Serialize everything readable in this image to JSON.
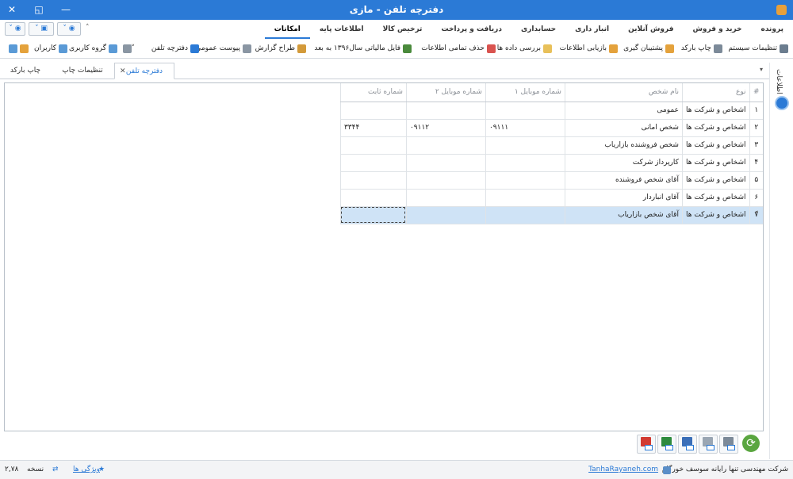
{
  "window": {
    "title": "دفترچه تلفن - مازی",
    "minimize_glyph": "—",
    "restore_glyph": "◱",
    "close_glyph": "✕"
  },
  "menu": {
    "tabs": [
      {
        "label": "پرونده"
      },
      {
        "label": "خرید و فروش"
      },
      {
        "label": "فروش آنلاین"
      },
      {
        "label": "انبار داری"
      },
      {
        "label": "حسابداری"
      },
      {
        "label": "دریافت و پرداخت"
      },
      {
        "label": "ترخیص کالا"
      },
      {
        "label": "اطلاعات پایه"
      },
      {
        "label": "امکانات"
      }
    ],
    "active_tab": "امکانات",
    "collapse_caret": "˄"
  },
  "ribbon": {
    "items": [
      {
        "label": "تنظیمات سیستم",
        "icon": "gear-icon"
      },
      {
        "label": "چاپ بارکد",
        "icon": "barcode-printer-icon"
      },
      {
        "label": "پشتیبان گیری",
        "icon": "backup-icon"
      },
      {
        "label": "بازیابی اطلاعات",
        "icon": "restore-icon"
      },
      {
        "label": "بررسی داده ها",
        "icon": "data-check-icon"
      },
      {
        "label": "حذف تمامی اطلاعات",
        "icon": "delete-all-icon"
      },
      {
        "label": "فایل مالیاتی سال۱۳۹۶ به بعد",
        "icon": "tax-file-icon"
      },
      {
        "label": "طراح گزارش",
        "icon": "report-designer-icon"
      },
      {
        "label": "پیوست عمومی",
        "icon": "attachment-icon"
      },
      {
        "label": "دفترچه تلفن",
        "icon": "phonebook-icon"
      },
      {
        "label": "گروه کاربری",
        "icon": "user-group-icon"
      },
      {
        "label": "کاربران",
        "icon": "user-icon"
      }
    ]
  },
  "doc_tabs": [
    {
      "label": "دفترچه تلفن",
      "active": true
    },
    {
      "label": "تنظیمات چاپ"
    },
    {
      "label": "چاپ بارکد"
    }
  ],
  "side_panel": {
    "label": "اطلاعات"
  },
  "grid": {
    "columns": [
      "#",
      "نوع",
      "نام شخص",
      "شماره موبایل ۱",
      "شماره موبایل ۲",
      "شماره ثابت"
    ],
    "rows": [
      {
        "num": "۱",
        "type": "اشخاص و شرکت ها",
        "name": "عمومی",
        "mobile1": "",
        "mobile2": "",
        "phone": ""
      },
      {
        "num": "۲",
        "type": "اشخاص و شرکت ها",
        "name": "شخص امانی",
        "mobile1": "۰۹۱۱۱",
        "mobile2": "۰۹۱۱۲",
        "phone": "۳۳۴۴"
      },
      {
        "num": "۳",
        "type": "اشخاص و شرکت ها",
        "name": "شخص فروشنده بازاریاب",
        "mobile1": "",
        "mobile2": "",
        "phone": ""
      },
      {
        "num": "۴",
        "type": "اشخاص و شرکت ها",
        "name": "کارپرداز شرکت",
        "mobile1": "",
        "mobile2": "",
        "phone": ""
      },
      {
        "num": "۵",
        "type": "اشخاص و شرکت ها",
        "name": "آقای  شخص فروشنده",
        "mobile1": "",
        "mobile2": "",
        "phone": ""
      },
      {
        "num": "۶",
        "type": "اشخاص و شرکت ها",
        "name": "آقای انباردار",
        "mobile1": "",
        "mobile2": "",
        "phone": ""
      },
      {
        "num": "۷",
        "type": "اشخاص و شرکت ها",
        "name": "آقای شخص بازاریاب",
        "mobile1": "",
        "mobile2": "",
        "phone": ""
      }
    ],
    "selected_row": 7
  },
  "bottom_toolbar": {
    "buttons": [
      {
        "icon": "refresh-icon"
      },
      {
        "icon": "print-grid-icon"
      },
      {
        "icon": "print-preview-icon"
      },
      {
        "icon": "export-word-icon"
      },
      {
        "icon": "export-excel-icon"
      },
      {
        "icon": "export-pdf-icon"
      }
    ]
  },
  "status": {
    "company": "شرکت مهندسی تنها رایانه سوسف خورگام",
    "website": "TanhaRayaneh.com",
    "features": "ویژگی ها",
    "version_label": "نسخه",
    "version": "۲,۷۸"
  },
  "colors": {
    "accent": "#2b7ad6",
    "selection": "#cfe3f6",
    "refresh": "#5aa640"
  }
}
